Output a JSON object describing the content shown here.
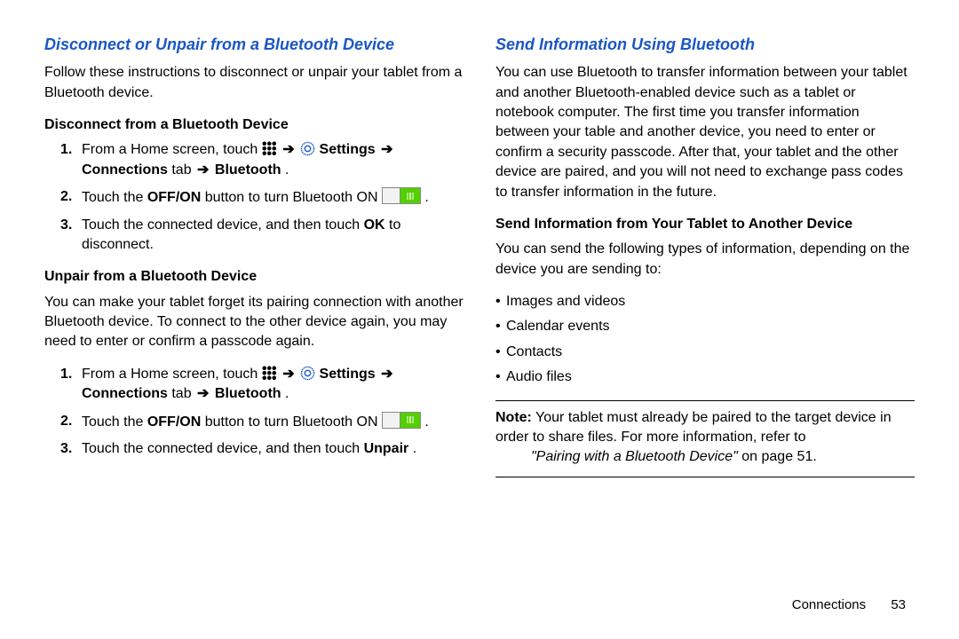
{
  "left": {
    "heading": "Disconnect or Unpair from a Bluetooth Device",
    "intro": "Follow these instructions to disconnect or unpair your tablet from a Bluetooth device.",
    "sec1_title": "Disconnect from a Bluetooth Device",
    "step1_pre": "From a Home screen, touch ",
    "step1_settings": "Settings",
    "step1_connections": "Connections",
    "step1_tab_word": " tab ",
    "step1_bt": "Bluetooth",
    "step1_end": ".",
    "step2_a": "Touch the ",
    "step2_offon": "OFF/ON",
    "step2_b": " button to turn Bluetooth ON ",
    "step2_end": ".",
    "step3_a": "Touch the connected device, and then touch ",
    "step3_ok": "OK",
    "step3_b": " to disconnect.",
    "sec2_title": "Unpair from a Bluetooth Device",
    "sec2_p": "You can make your tablet forget its pairing connection with another Bluetooth device. To connect to the other device again, you may need to enter or confirm a passcode again.",
    "u_step3_a": "Touch the connected device, and then touch ",
    "u_step3_unpair": "Unpair",
    "u_step3_end": "."
  },
  "right": {
    "heading": "Send Information Using Bluetooth",
    "intro": "You can use Bluetooth to transfer information between your tablet and another Bluetooth-enabled device such as a tablet or notebook computer. The first time you transfer information between your table and another device, you need to enter or confirm a security passcode. After that, your tablet and the other device are paired, and you will not need to exchange pass codes to transfer information in the future.",
    "sec1_title": "Send Information from Your Tablet to Another Device",
    "sec1_p": "You can send the following types of information, depending on the device you are sending to:",
    "bullets": {
      "b1": "Images and videos",
      "b2": "Calendar events",
      "b3": "Contacts",
      "b4": "Audio files"
    },
    "note_label": "Note:",
    "note_body": " Your tablet must already be paired to the target device in order to share files. For more information, refer to ",
    "note_ref": "\"Pairing with a Bluetooth Device\"",
    "note_page": " on page 51."
  },
  "footer": {
    "section": "Connections",
    "page": "53"
  }
}
